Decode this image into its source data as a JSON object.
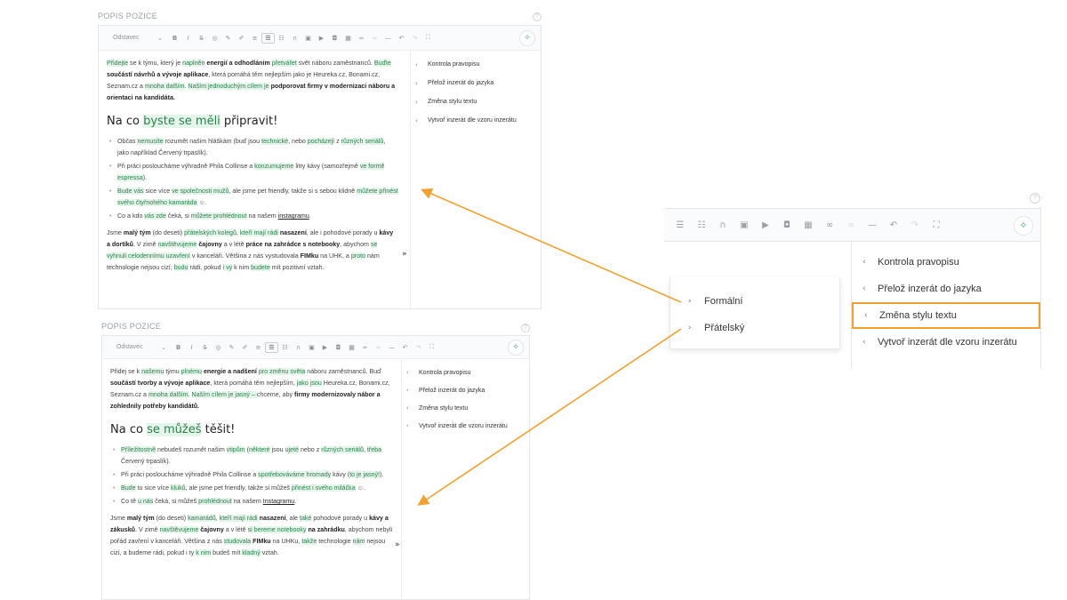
{
  "section_label": "POPIS POZICE",
  "help_symbol": "?",
  "toolbar": {
    "style_select": "Odstavec",
    "icons": [
      "bold-icon",
      "italic-icon",
      "strikethrough-icon",
      "paint-icon",
      "marker-icon",
      "brush-icon",
      "align-icon",
      "bullet-list-icon",
      "numbered-list-icon",
      "quote-icon",
      "image-icon",
      "video-icon",
      "embed-icon",
      "table-icon",
      "link-icon",
      "unlink-icon",
      "hr-icon",
      "undo-icon",
      "redo-icon",
      "fullscreen-icon"
    ],
    "magic_icon": "magic-wand-icon"
  },
  "toggle_symbol": "»",
  "menu": {
    "items": [
      "Kontrola pravopisu",
      "Přelož inzerát do jazyka",
      "Změna stylu textu",
      "Vytvoř inzerát dle vzoru inzerátu"
    ]
  },
  "submenu": {
    "items": [
      "Formální",
      "Přátelský"
    ]
  },
  "highlight_color": "#f2a032",
  "accent_green": "#39a37a",
  "top_editor": {
    "heading": "Na co byste se měli připravit!",
    "bullets": [
      "Občas nemusíte rozumět našim hláškám (buď jsou technické, nebo pocházejí z různých seriálů, jako například Červený trpaslík).",
      "Při práci posloucháme výhradně Phila Collinse a konzumujeme litry kávy (samozřejmě ve formě espressa).",
      "Bude vás sice více ve společnosti mužů, ale jsme pet friendly, takže si s sebou klidně můžete přinést svého čtyřnohého kamaráda ☺.",
      "Co a kdo vás zde čeká, si můžete prohlédnout na našem instagramu."
    ]
  },
  "bottom_editor": {
    "heading": "Na co se můžeš těšit!",
    "bullets": [
      "Příležitostně nebudeš rozumět našim vtipům (některé jsou ujeté nebo z různých seriálů, třeba Červený trpaslík).",
      "Při práci posloucháme výhradně Phila Collinse a spotřebováváme hromady kávy (to je jasný!).",
      "Bude tu sice více kluků, ale jsme pet friendly, takže si můžeš přinést i svého miláčka ☺.",
      "Co tě u nás čeká, si můžeš prohlédnout na našem Instagramu."
    ]
  }
}
